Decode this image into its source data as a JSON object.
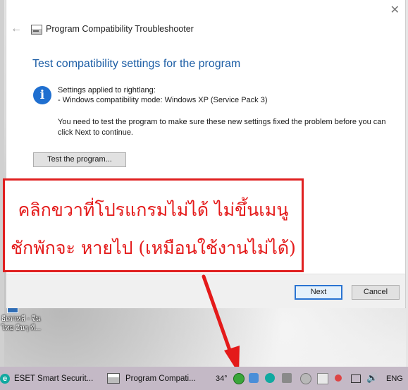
{
  "window": {
    "title": "Program Compatibility Troubleshooter",
    "heading": "Test compatibility settings for the program",
    "settings_line1": "Settings applied to rightlang:",
    "settings_line2": "- Windows compatibility mode: Windows XP (Service Pack 3)",
    "note": "You need to test the program to make sure these new settings fixed the problem before you can click Next to continue.",
    "test_button": "Test the program...",
    "next_button": "Next",
    "cancel_button": "Cancel",
    "close_glyph": "✕",
    "back_glyph": "←",
    "info_glyph": "i"
  },
  "annotation": {
    "line1": "คลิกขวาที่โปรแกรมไม่ได้ ไม่ขึ้นเมนู",
    "line2": "ชักพักจะ หายไป (เหมือนใช้งานไม่ได้)",
    "color": "#e41a1a"
  },
  "desktop": {
    "icon_label": "ธีเกาหลี - จีน ไทย อีนๆ ที..."
  },
  "taskbar": {
    "items": [
      {
        "label": "ESET Smart Securit...",
        "icon": "eset-icon"
      },
      {
        "label": "Program Compati...",
        "icon": "troubleshooter-icon"
      }
    ],
    "temperature": "34°",
    "language": "ENG",
    "background": "#c4b9c6"
  }
}
